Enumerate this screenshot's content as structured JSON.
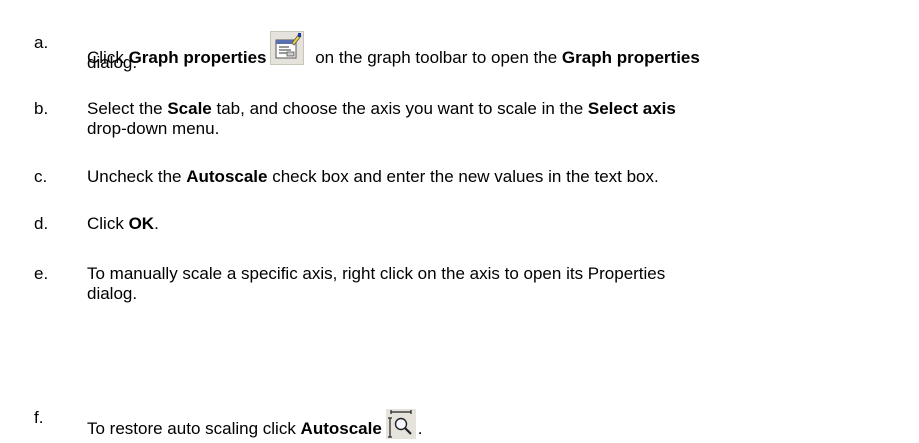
{
  "steps": [
    {
      "letter": "a.",
      "line1": [
        {
          "text": "Click ",
          "bold": false
        },
        {
          "text": "Graph properties",
          "bold": true
        },
        {
          "icon": "graph-properties-icon"
        },
        {
          "text": " on the graph toolbar to open the ",
          "bold": false
        },
        {
          "text": "Graph properties",
          "bold": true
        }
      ],
      "line2": [
        {
          "text": "dialog.",
          "bold": false
        }
      ]
    },
    {
      "letter": "b.",
      "line1": [
        {
          "text": "Select the ",
          "bold": false
        },
        {
          "text": "Scale",
          "bold": true
        },
        {
          "text": " tab, and choose the axis you want to scale in the ",
          "bold": false
        },
        {
          "text": "Select axis",
          "bold": true
        }
      ],
      "line2": [
        {
          "text": "drop-down menu.",
          "bold": false
        }
      ]
    },
    {
      "letter": "c.",
      "line1": [
        {
          "text": "Uncheck the ",
          "bold": false
        },
        {
          "text": "Autoscale",
          "bold": true
        },
        {
          "text": " check box and enter the new values in the text box.",
          "bold": false
        }
      ]
    },
    {
      "letter": "d.",
      "line1": [
        {
          "text": "Click ",
          "bold": false
        },
        {
          "text": "OK",
          "bold": true
        },
        {
          "text": ".",
          "bold": false
        }
      ]
    },
    {
      "letter": "e.",
      "line1": [
        {
          "text": "To manually scale a specific axis, right click on the axis to open its Properties",
          "bold": false
        }
      ],
      "line2": [
        {
          "text": "dialog.",
          "bold": false
        }
      ]
    },
    {
      "letter": "f.",
      "line1": [
        {
          "text": "To restore auto scaling click ",
          "bold": false
        },
        {
          "text": "Autoscale",
          "bold": true
        },
        {
          "icon": "autoscale-icon"
        },
        {
          "text": ".",
          "bold": false
        }
      ]
    }
  ]
}
